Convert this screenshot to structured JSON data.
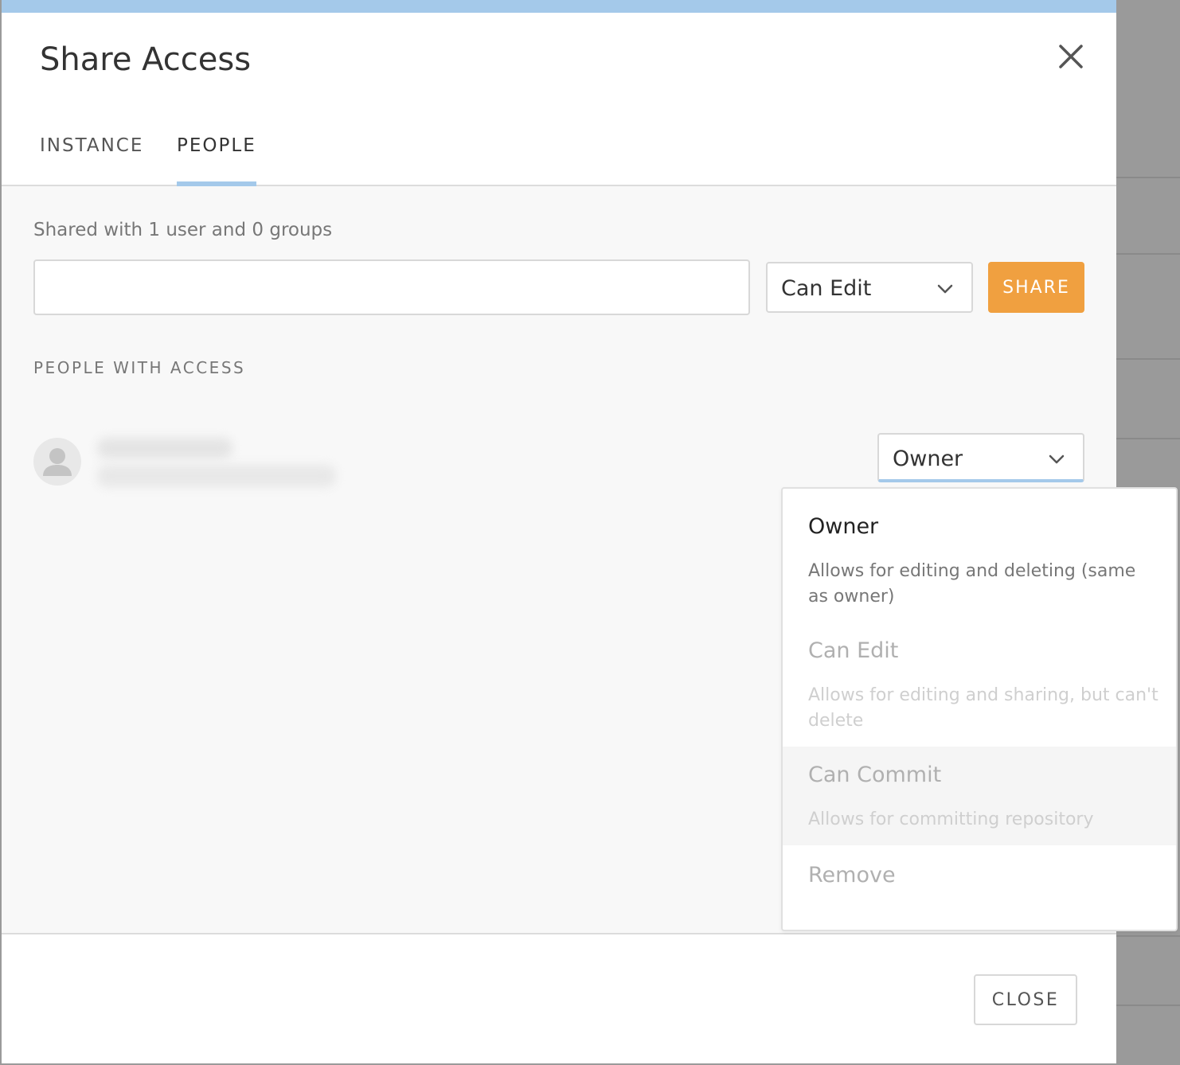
{
  "dialog": {
    "title": "Share Access",
    "close_icon": "close-icon"
  },
  "tabs": [
    {
      "label": "INSTANCE",
      "active": false
    },
    {
      "label": "PEOPLE",
      "active": true
    }
  ],
  "share": {
    "summary": "Shared with 1 user and 0 groups",
    "input_value": "",
    "permission_selected": "Can Edit",
    "share_button": "SHARE"
  },
  "people": {
    "heading": "PEOPLE WITH ACCESS",
    "rows": [
      {
        "avatar_icon": "user-avatar-icon",
        "role": "Owner"
      }
    ]
  },
  "role_menu": {
    "options": [
      {
        "title": "Owner",
        "description": "Allows for editing and deleting (same as owner)"
      },
      {
        "title": "Can Edit",
        "description": "Allows for editing and sharing, but can't delete"
      },
      {
        "title": "Can Commit",
        "description": "Allows for committing repository"
      },
      {
        "title": "Remove"
      }
    ]
  },
  "footer": {
    "close_button": "CLOSE"
  },
  "colors": {
    "accent_blue": "#a4c9ea",
    "share_orange": "#f0a040",
    "backdrop": "#9a9a9a"
  }
}
